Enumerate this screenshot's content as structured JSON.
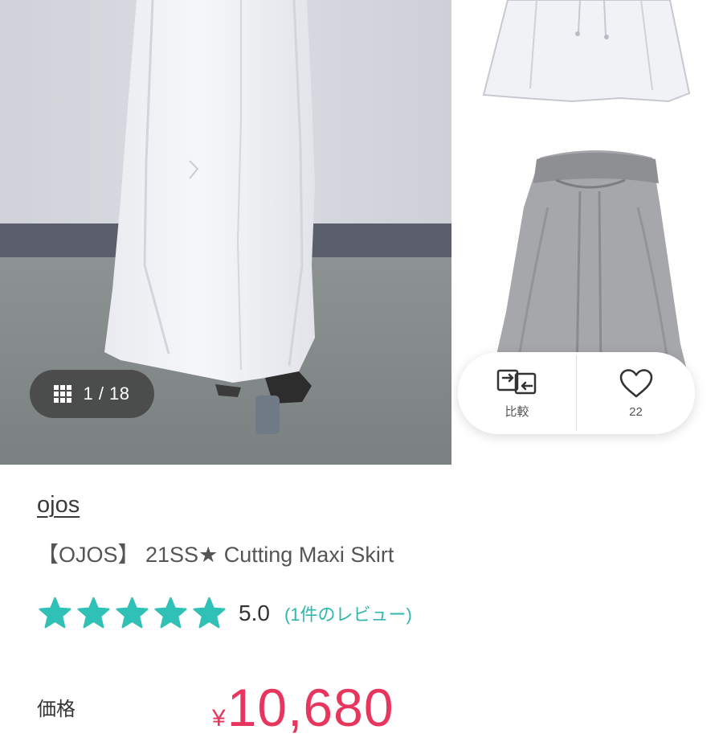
{
  "gallery": {
    "counter": "1 / 18",
    "current_image": 1,
    "total_images": 18
  },
  "actions": {
    "compare_label": "比較",
    "favorite_count": "22"
  },
  "product": {
    "brand": "ojos",
    "title": "【OJOS】 21SS★ Cutting Maxi Skirt",
    "rating": {
      "value": "5.0",
      "stars": 5,
      "max_stars": 5,
      "review_text": "(1件のレビュー)"
    },
    "price": {
      "label": "価格",
      "currency": "¥",
      "amount": "10,680"
    }
  },
  "colors": {
    "star": "#2fc1b5",
    "review_link": "#2fb7ad",
    "price": "#e8355e"
  },
  "icons": {
    "counter": "grid-icon",
    "compare": "compare-arrows-icon",
    "favorite": "heart-outline-icon",
    "star": "star-icon"
  }
}
